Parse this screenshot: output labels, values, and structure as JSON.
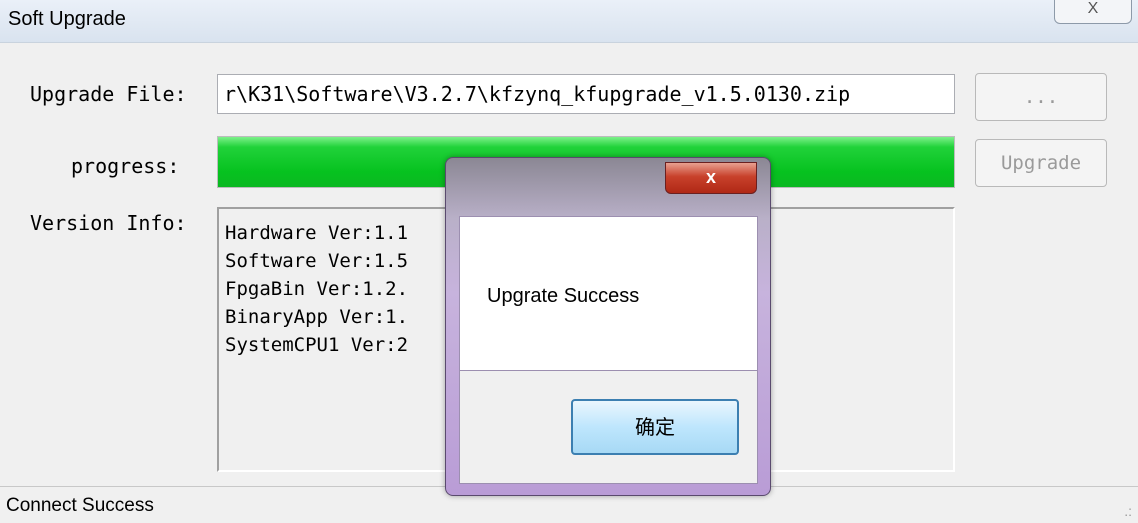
{
  "window": {
    "title": "Soft Upgrade",
    "close_glyph": "X",
    "close_icon": "close-icon"
  },
  "form": {
    "upgrade_file_label": "Upgrade File:",
    "upgrade_file_value": "r\\K31\\Software\\V3.2.7\\kfzynq_kfupgrade_v1.5.0130.zip",
    "browse_label": "...",
    "progress_label": "progress:",
    "progress_fraction": 1.0,
    "upgrade_label": "Upgrade",
    "version_info_label": "Version Info:",
    "version_lines": [
      "Hardware Ver:1.1",
      "Software Ver:1.5",
      "FpgaBin Ver:1.2.",
      "BinaryApp Ver:1.",
      "SystemCPU1 Ver:2"
    ]
  },
  "status": {
    "text": "Connect Success"
  },
  "dialog": {
    "close_glyph": "x",
    "message": "Upgrate Success",
    "ok_label": "确定"
  },
  "colors": {
    "progress_green": "#06c21f",
    "dialog_frame": "#b99cd6"
  }
}
